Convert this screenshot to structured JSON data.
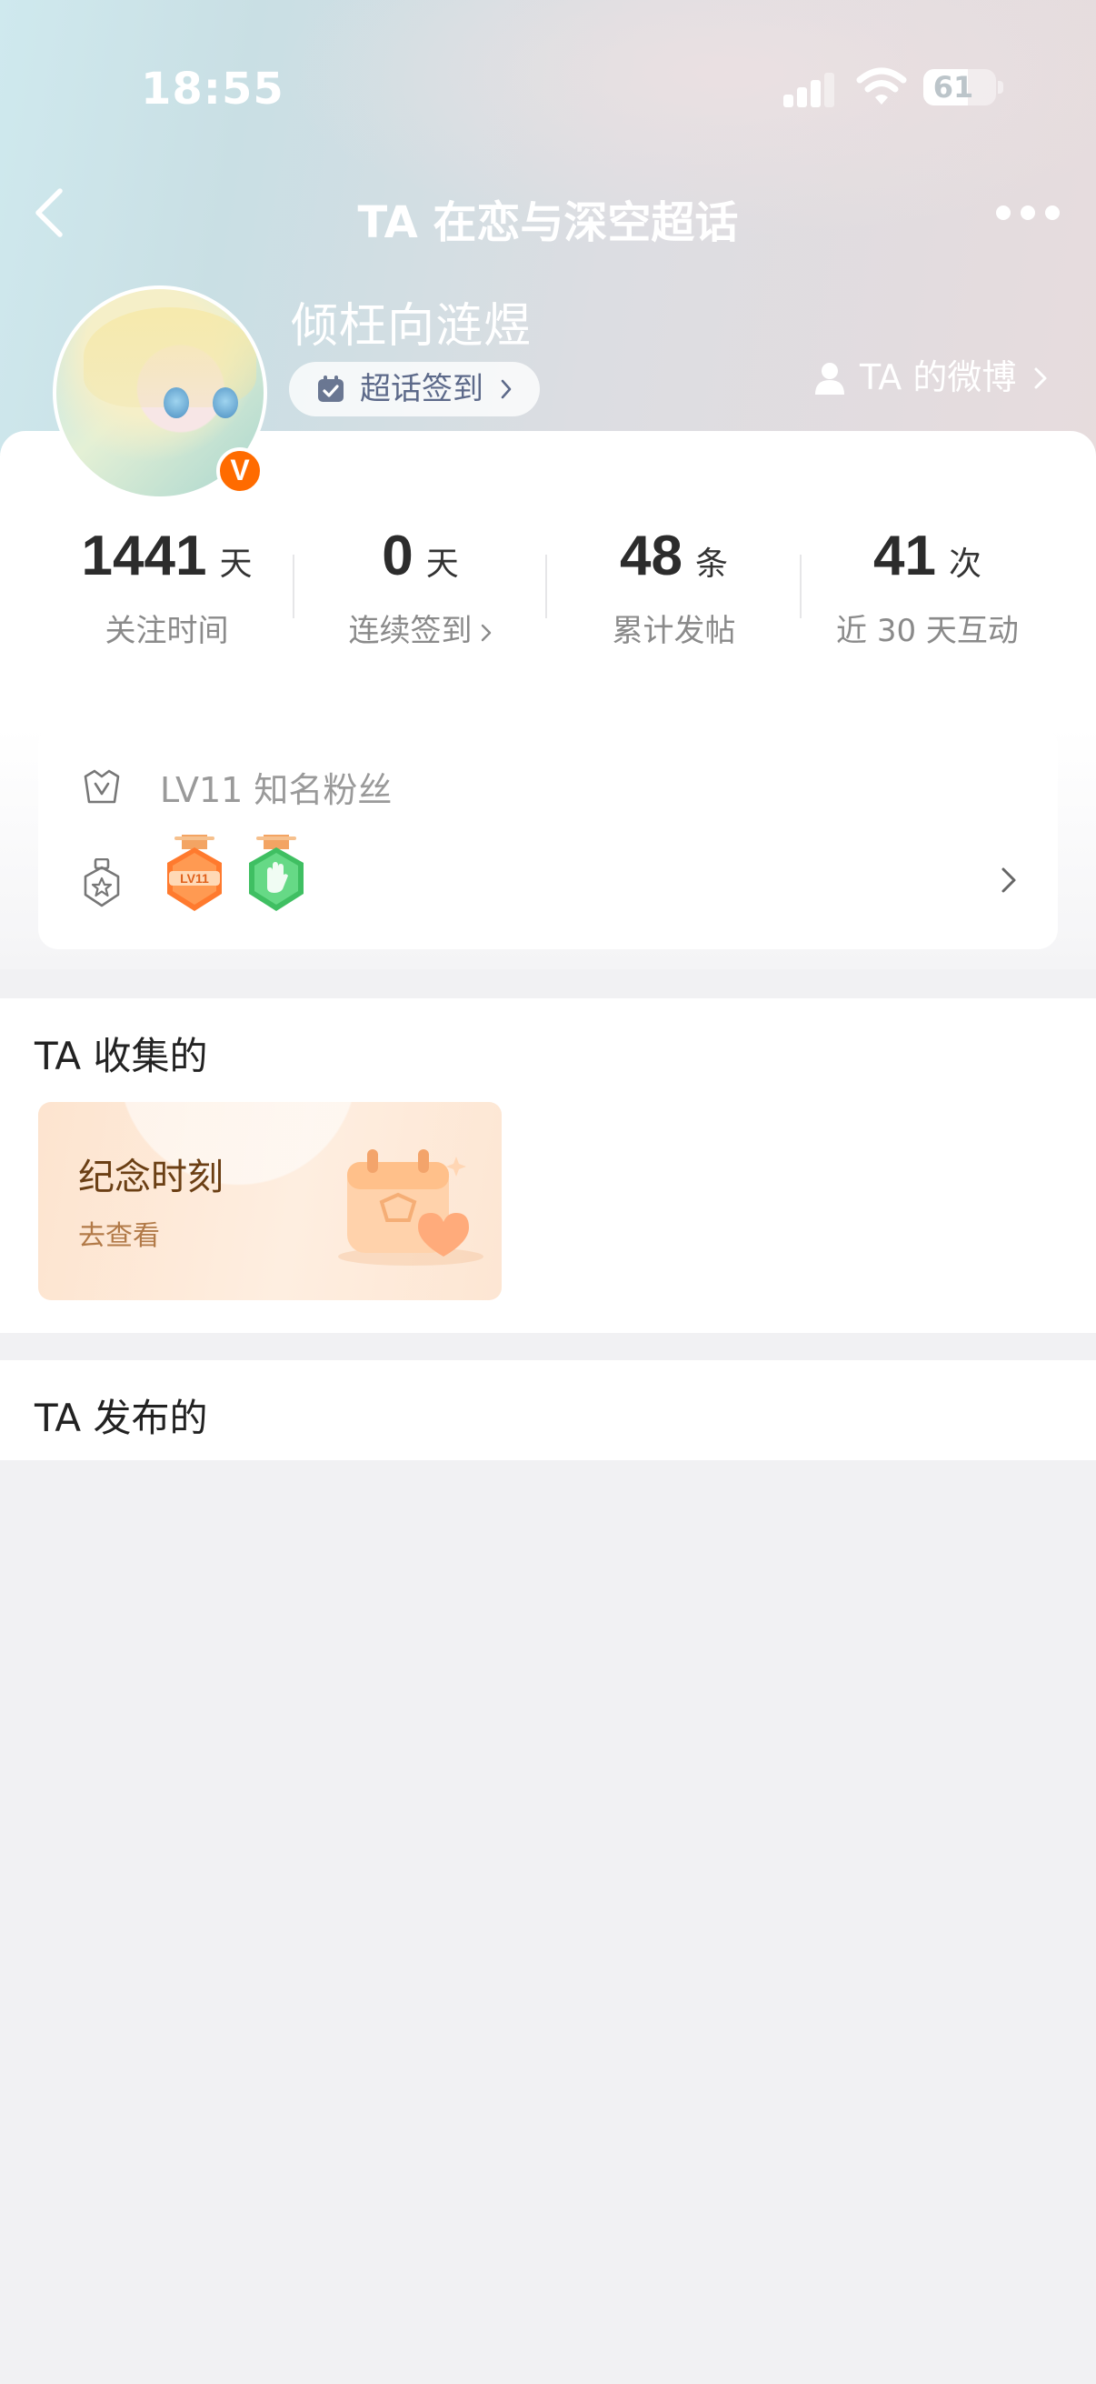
{
  "status_bar": {
    "time": "18:55",
    "battery": "61",
    "battery_level": 0.61
  },
  "nav": {
    "title": "TA 在恋与深空超话",
    "back_icon": "chevron-left-icon",
    "more_icon": "more-dots-icon"
  },
  "profile": {
    "username": "倾枉向涟煜",
    "verified_badge": "V",
    "checkin_label": "超话签到",
    "weibo_link_label": "TA 的微博"
  },
  "stats": [
    {
      "value": "1441",
      "unit": "天",
      "label": "关注时间"
    },
    {
      "value": "0",
      "unit": "天",
      "label": "连续签到"
    },
    {
      "value": "48",
      "unit": "条",
      "label": "累计发帖"
    },
    {
      "value": "41",
      "unit": "次",
      "label": "近 30 天互动"
    }
  ],
  "fan_card": {
    "level_text": "LV11 知名粉丝",
    "medals": [
      "lv11-medal-icon",
      "hand-medal-icon"
    ],
    "medal_1_label": "LV11"
  },
  "collect_section": {
    "title": "TA 收集的",
    "card_title": "纪念时刻",
    "card_sub": "去查看"
  },
  "publish_section": {
    "title": "TA 发布的"
  },
  "colors": {
    "accent_orange": "#ff6b00",
    "text_dark": "#2c2c2c",
    "text_gray": "#8a8a8a",
    "page_bg": "#f1f1f3"
  }
}
